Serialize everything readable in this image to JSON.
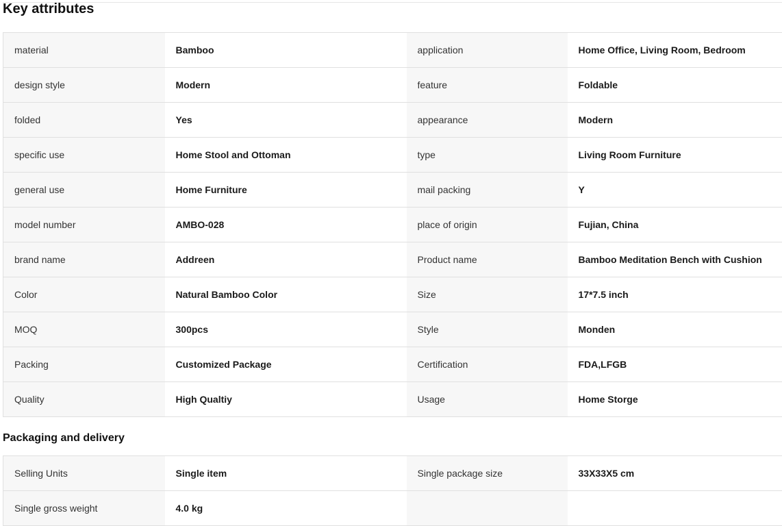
{
  "sections": {
    "key_attributes": {
      "title": "Key attributes",
      "rows": [
        {
          "k1": "material",
          "v1": "Bamboo",
          "k2": "application",
          "v2": "Home Office, Living Room, Bedroom"
        },
        {
          "k1": "design style",
          "v1": "Modern",
          "k2": "feature",
          "v2": "Foldable"
        },
        {
          "k1": "folded",
          "v1": "Yes",
          "k2": "appearance",
          "v2": "Modern"
        },
        {
          "k1": "specific use",
          "v1": "Home Stool and Ottoman",
          "k2": "type",
          "v2": "Living Room Furniture"
        },
        {
          "k1": "general use",
          "v1": "Home Furniture",
          "k2": "mail packing",
          "v2": "Y"
        },
        {
          "k1": "model number",
          "v1": "AMBO-028",
          "k2": "place of origin",
          "v2": "Fujian, China"
        },
        {
          "k1": "brand name",
          "v1": "Addreen",
          "k2": "Product name",
          "v2": "Bamboo Meditation Bench with Cushion"
        },
        {
          "k1": "Color",
          "v1": "Natural Bamboo Color",
          "k2": "Size",
          "v2": "17*7.5 inch"
        },
        {
          "k1": "MOQ",
          "v1": "300pcs",
          "k2": "Style",
          "v2": "Monden"
        },
        {
          "k1": "Packing",
          "v1": "Customized Package",
          "k2": "Certification",
          "v2": "FDA,LFGB"
        },
        {
          "k1": "Quality",
          "v1": "High Qualtiy",
          "k2": "Usage",
          "v2": "Home Storge"
        }
      ]
    },
    "packaging_delivery": {
      "title": "Packaging and delivery",
      "rows": [
        {
          "k1": "Selling Units",
          "v1": "Single item",
          "k2": "Single package size",
          "v2": "33X33X5 cm"
        },
        {
          "k1": "Single gross weight",
          "v1": "4.0 kg",
          "k2": "",
          "v2": ""
        }
      ]
    }
  },
  "colors": {
    "key_cell_background": "#f7f7f7",
    "value_cell_background": "#ffffff",
    "border": "#e0e0e0",
    "text": "#222222"
  }
}
